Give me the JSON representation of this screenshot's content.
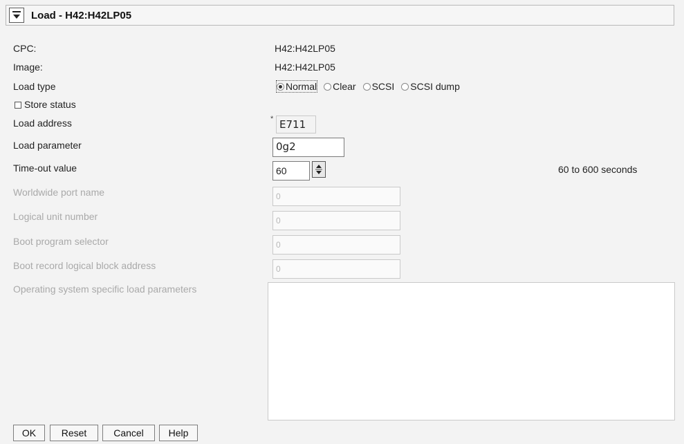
{
  "title": "Load - H42:H42LP05",
  "fields": {
    "cpc_label": "CPC:",
    "cpc_value": "H42:H42LP05",
    "image_label": "Image:",
    "image_value": "H42:H42LP05",
    "load_type_label": "Load type",
    "load_type_options": [
      "Normal",
      "Clear",
      "SCSI",
      "SCSI dump"
    ],
    "load_type_selected": "Normal",
    "store_status_label": "Store status",
    "load_address_label": "Load address",
    "load_address_value": "E711",
    "required_marker": "*",
    "load_parameter_label": "Load parameter",
    "load_parameter_value": "0g2",
    "timeout_label": "Time-out value",
    "timeout_value": "60",
    "timeout_range": "60 to 600 seconds",
    "wwpn_label": "Worldwide port name",
    "wwpn_value": "0",
    "lun_label": "Logical unit number",
    "lun_value": "0",
    "bps_label": "Boot program selector",
    "bps_value": "0",
    "brlba_label": "Boot record logical block address",
    "brlba_value": "0",
    "os_params_label": "Operating system specific load parameters",
    "os_params_value": ""
  },
  "buttons": {
    "ok": "OK",
    "reset": "Reset",
    "cancel": "Cancel",
    "help": "Help"
  },
  "icons": {
    "menu": "chevron-down-menu-icon",
    "spinner": "up-down-spinner-icon"
  },
  "colors": {
    "background": "#f3f3f3",
    "disabled_text": "#a9a9a9"
  }
}
